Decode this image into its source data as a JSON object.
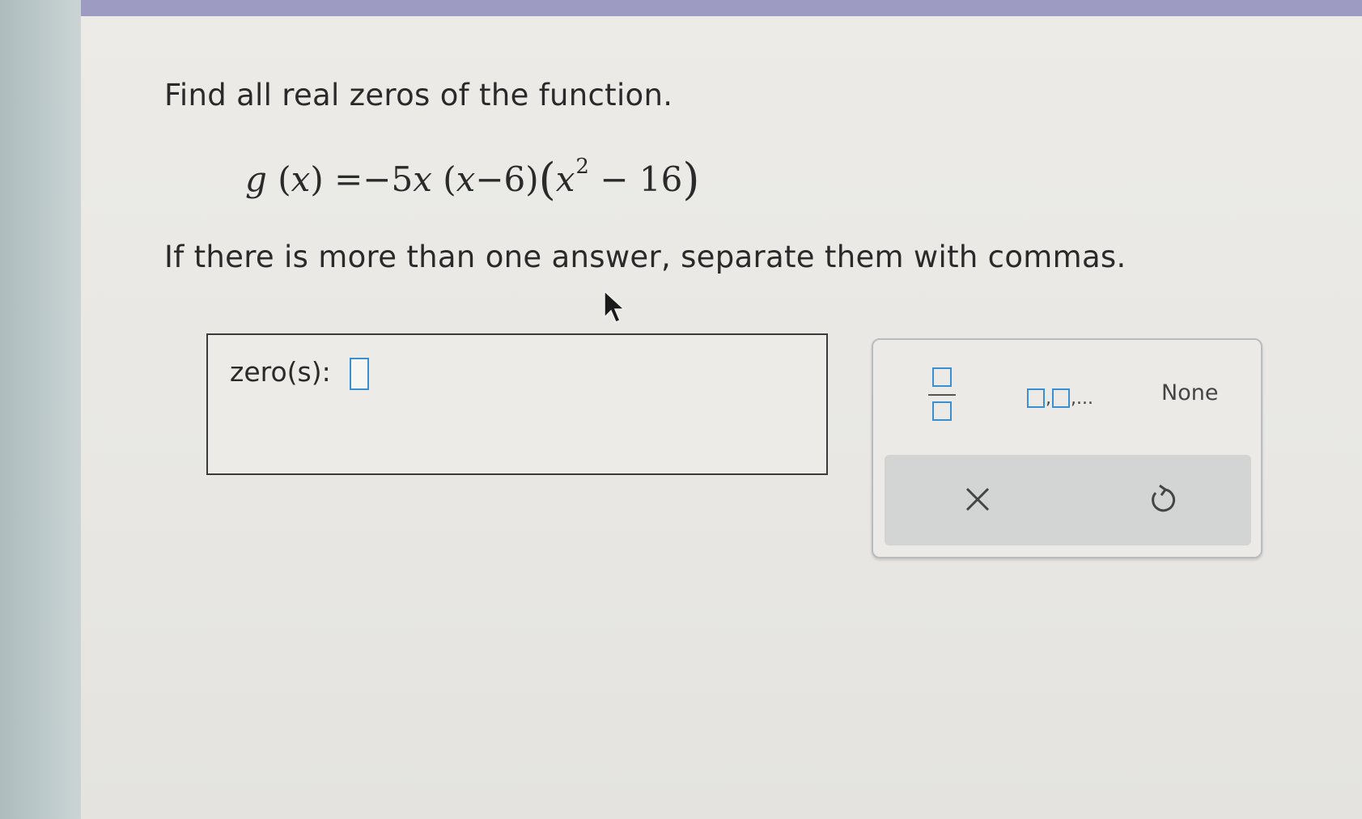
{
  "question": {
    "prompt": "Find all real zeros of the function.",
    "instruction": "If there is more than one answer, separate them with commas."
  },
  "equation": {
    "g": "g",
    "x1": "x",
    "eq": "=",
    "coef": "−5",
    "x2": "x",
    "x3": "x",
    "minus6": "−6",
    "x4": "x",
    "exp": "2",
    "minus16": "− 16"
  },
  "answer": {
    "label": "zero(s):",
    "value": ""
  },
  "keypad": {
    "none_label": "None",
    "list_sep": ",",
    "list_ellipsis": ",..."
  },
  "colors": {
    "accent": "#3a8fd0",
    "top_bar": "#9d9bc2"
  }
}
